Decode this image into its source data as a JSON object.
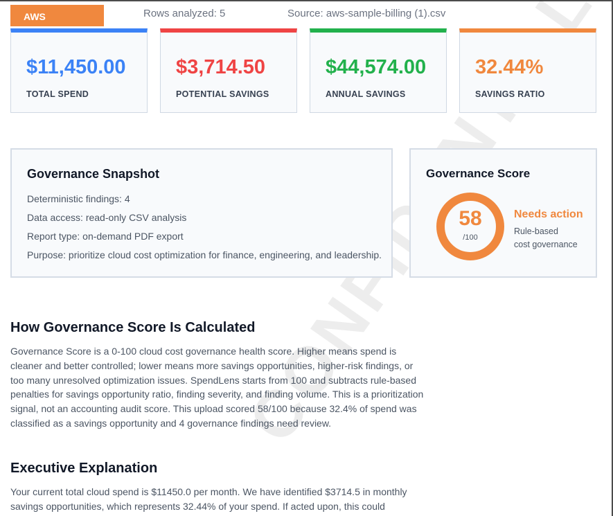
{
  "header": {
    "provider": "AWS",
    "rows_analyzed": "Rows analyzed: 5",
    "source": "Source: aws-sample-billing (1).csv"
  },
  "watermark": "CONFIDENTIAL",
  "kpis": [
    {
      "value": "$11,450.00",
      "label": "TOTAL SPEND",
      "color": "#3b82f6"
    },
    {
      "value": "$3,714.50",
      "label": "POTENTIAL SAVINGS",
      "color": "#ef4444"
    },
    {
      "value": "$44,574.00",
      "label": "ANNUAL SAVINGS",
      "color": "#22b14c"
    },
    {
      "value": "32.44%",
      "label": "SAVINGS RATIO",
      "color": "#f0883e"
    }
  ],
  "snapshot": {
    "title": "Governance Snapshot",
    "lines": [
      "Deterministic findings: 4",
      "Data access: read-only CSV analysis",
      "Report type: on-demand PDF export",
      "Purpose: prioritize cloud cost optimization for finance, engineering, and leadership."
    ]
  },
  "score": {
    "title": "Governance Score",
    "value": "58",
    "max": "/100",
    "fraction": 0.58,
    "status": "Needs action",
    "sub1": "Rule-based",
    "sub2": "cost governance",
    "accent": "#f0883e"
  },
  "how": {
    "heading": "How Governance Score Is Calculated",
    "body": "Governance Score is a 0-100 cloud cost governance health score. Higher means spend is cleaner and better controlled; lower means more savings opportunities, higher-risk findings, or too many unresolved optimization issues. SpendLens starts from 100 and subtracts rule-based penalties for savings opportunity ratio, finding severity, and finding volume. This is a prioritization signal, not an accounting audit score. This upload scored 58/100 because 32.4% of spend was classified as a savings opportunity and 4 governance findings need review."
  },
  "exec": {
    "heading": "Executive Explanation",
    "body": "Your current total cloud spend is $11450.0 per month. We have identified $3714.5 in monthly savings opportunities, which represents 32.44% of your spend. If acted upon, this could"
  }
}
